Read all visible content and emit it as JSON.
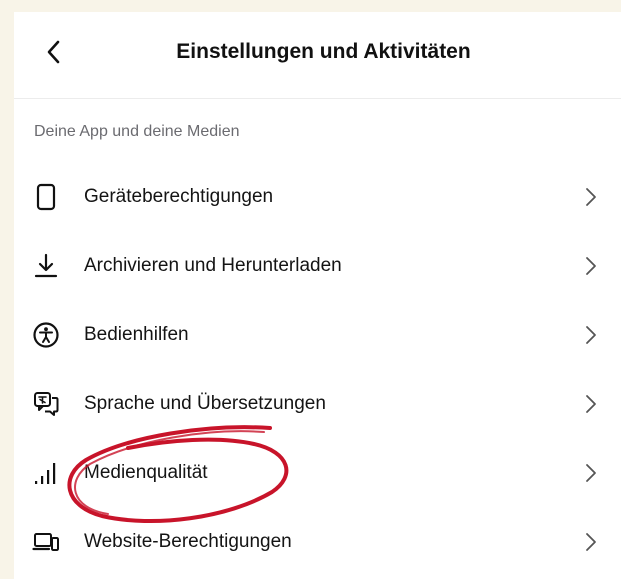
{
  "header": {
    "title": "Einstellungen und Aktivitäten",
    "back_icon": "chevron-left-icon"
  },
  "section": {
    "label": "Deine App und deine Medien",
    "items": [
      {
        "label": "Geräteberechtigungen",
        "icon": "phone-icon"
      },
      {
        "label": "Archivieren und Herunterladen",
        "icon": "download-icon"
      },
      {
        "label": "Bedienhilfen",
        "icon": "accessibility-icon"
      },
      {
        "label": "Sprache und Übersetzungen",
        "icon": "translate-icon"
      },
      {
        "label": "Medienqualität",
        "icon": "signal-bars-icon"
      },
      {
        "label": "Website-Berechtigungen",
        "icon": "devices-icon"
      }
    ]
  },
  "colors": {
    "page_background": "#f8f4e8",
    "panel_background": "#ffffff",
    "secondary_text": "#6b6b70",
    "annotation_red": "#c8142a"
  },
  "annotation": {
    "type": "hand-drawn-circle",
    "target": "Medienqualität"
  }
}
